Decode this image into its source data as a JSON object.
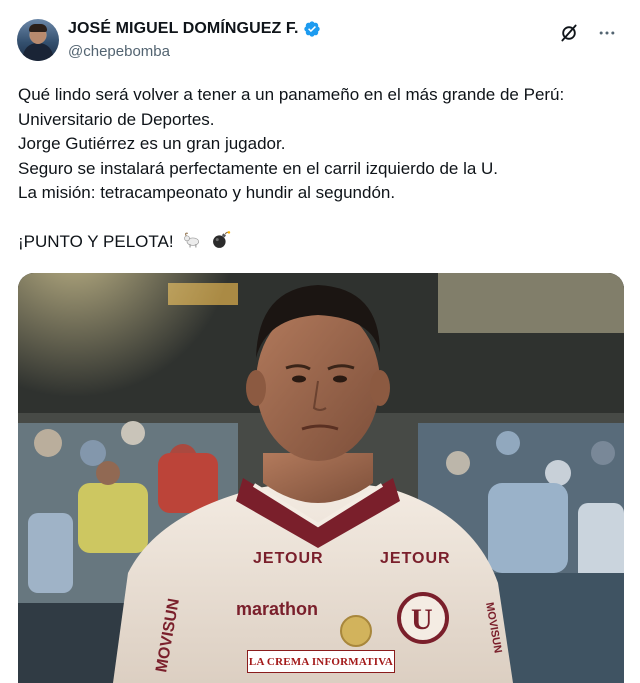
{
  "author": {
    "display_name": "JOSÉ MIGUEL DOMÍNGUEZ F.",
    "handle": "@chepebomba",
    "verified": true,
    "avatar_icon": "profile-avatar"
  },
  "header_actions": {
    "grok_icon": "grok-icon",
    "more_icon": "more-options-icon"
  },
  "tweet": {
    "lines": [
      "Qué lindo será volver a tener a un panameño en el más grande de Perú:",
      "Universitario de Deportes.",
      "Jorge Gutiérrez es un gran jugador.",
      "Seguro se instalará perfectamente en el carril izquierdo de la U.",
      "La misión: tetracampeonato y hundir al segundón."
    ],
    "closing": "¡PUNTO Y PELOTA!",
    "closing_emojis": [
      "goat-emoji",
      "bomb-emoji"
    ]
  },
  "media": {
    "jersey_sponsor_chest_left": "JETOUR",
    "jersey_sponsor_chest_right": "JETOUR",
    "jersey_sponsor_main": "marathon",
    "jersey_sleeve": "MOVISUN",
    "watermark": "LA CREMA INFORMATIVA"
  },
  "colors": {
    "verified_blue": "#1d9bf0",
    "text_primary": "#0f1419",
    "text_secondary": "#536471",
    "jersey_maroon": "#7a1f2b",
    "jersey_cream": "#f1e7dc"
  }
}
